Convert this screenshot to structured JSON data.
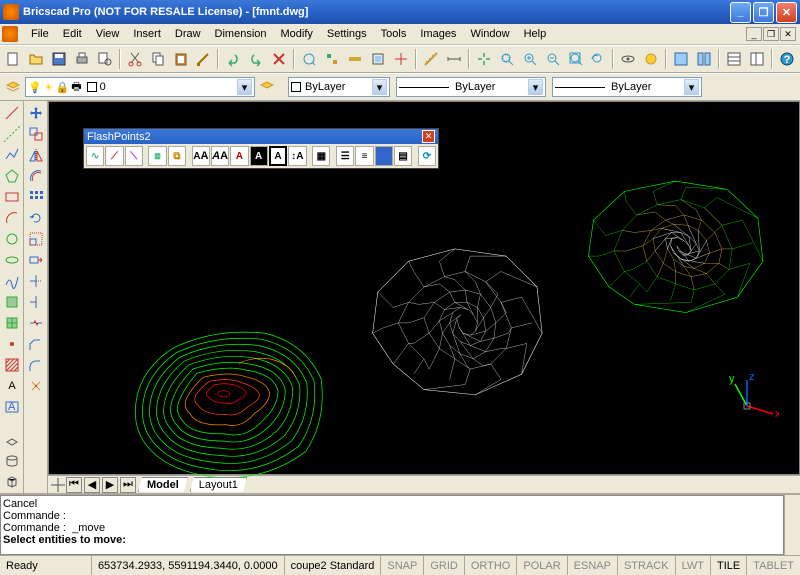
{
  "title": "Bricscad Pro (NOT FOR RESALE License) - [fmnt.dwg]",
  "menu": [
    "File",
    "Edit",
    "View",
    "Insert",
    "Draw",
    "Dimension",
    "Modify",
    "Settings",
    "Tools",
    "Images",
    "Window",
    "Help"
  ],
  "layer": {
    "current": "0"
  },
  "props": {
    "color": "ByLayer",
    "linetype": "ByLayer",
    "lineweight": "ByLayer"
  },
  "tabs": {
    "active": "Model",
    "others": [
      "Layout1"
    ]
  },
  "cmd": {
    "l1": "Cancel",
    "l2": "Commande :",
    "l3": "Commande :  _move",
    "prompt": "Select entities to move:"
  },
  "status": {
    "ready": "Ready",
    "coords": "653734.2933, 5591194.3440, 0.0000",
    "style": "coupe2 Standard",
    "toggles": [
      "SNAP",
      "GRID",
      "ORTHO",
      "POLAR",
      "ESNAP",
      "STRACK",
      "LWT",
      "TILE",
      "TABLET"
    ]
  },
  "float": {
    "title": "FlashPoints2"
  },
  "ucs": {
    "x": "x",
    "y": "y",
    "z": "z"
  }
}
